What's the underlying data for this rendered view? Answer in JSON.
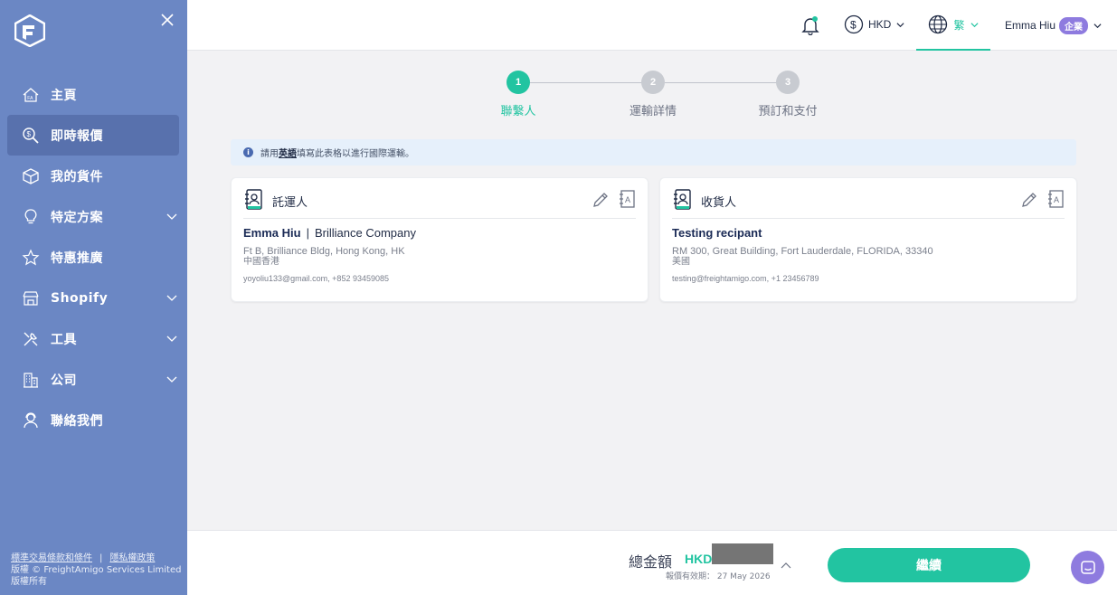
{
  "sidebar": {
    "items": [
      {
        "label": "主頁",
        "icon": "home-icon",
        "active": false,
        "expandable": false
      },
      {
        "label": "即時報價",
        "icon": "quote-icon",
        "active": true,
        "expandable": false
      },
      {
        "label": "我的貨件",
        "icon": "box-icon",
        "active": false,
        "expandable": false
      },
      {
        "label": "特定方案",
        "icon": "lightbulb-icon",
        "active": false,
        "expandable": true
      },
      {
        "label": "特惠推廣",
        "icon": "star-icon",
        "active": false,
        "expandable": false
      },
      {
        "label": "Shopify",
        "icon": "store-icon",
        "active": false,
        "expandable": true
      },
      {
        "label": "工具",
        "icon": "tools-icon",
        "active": false,
        "expandable": true
      },
      {
        "label": "公司",
        "icon": "building-icon",
        "active": false,
        "expandable": true
      },
      {
        "label": "聯絡我們",
        "icon": "support-agent-icon",
        "active": false,
        "expandable": false
      }
    ],
    "footer": {
      "terms": "標準交易條款和條件",
      "privacy": "隱私權政策",
      "copyright": "版權 © FreightAmigo Services Limited",
      "rights": "版權所有"
    }
  },
  "header": {
    "currency": "HKD",
    "language": "繁",
    "user_name": "Emma Hiu",
    "user_badge": "企業"
  },
  "stepper": {
    "steps": [
      {
        "num": "1",
        "label": "聯繫人",
        "active": true
      },
      {
        "num": "2",
        "label": "運輸詳情",
        "active": false
      },
      {
        "num": "3",
        "label": "預訂和支付",
        "active": false
      }
    ]
  },
  "info": {
    "prefix": "請用",
    "emphasis": "英語",
    "suffix": "填寫此表格以進行國際運輸。"
  },
  "shipper": {
    "title": "託運人",
    "name": "Emma Hiu",
    "company": "Brilliance Company",
    "address": "Ft B, Brilliance Bldg, Hong Kong, HK",
    "country": "中國香港",
    "contact": "yoyoliu133@gmail.com,  +852 93459085"
  },
  "consignee": {
    "title": "收貨人",
    "name": "Testing recipant",
    "address": "RM 300, Great Building, Fort Lauderdale, FLORIDA, 33340",
    "country": "美國",
    "contact": "testing@freightamigo.com,  +1 23456789"
  },
  "footer": {
    "total_label": "總金額",
    "total_currency": "HKD",
    "valid_text": "報價有效期： 27 May 2026",
    "continue_label": "繼續"
  },
  "colors": {
    "sidebar": "#6b87c4",
    "accent": "#22c4a1",
    "badge": "#8e7bdf"
  }
}
